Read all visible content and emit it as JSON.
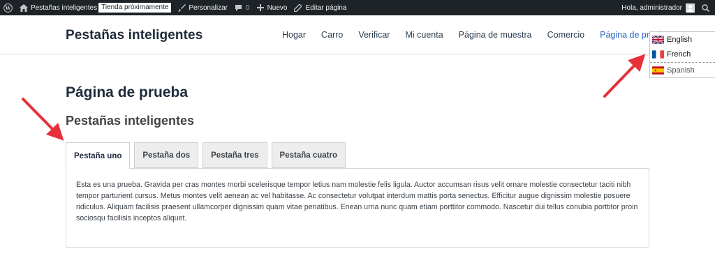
{
  "admin_bar": {
    "site_name": "Pestañas inteligentes",
    "badge": "Tienda próximamente",
    "customize": "Personalizar",
    "comments_count": "0",
    "new_label": "Nuevo",
    "edit_page": "Editar página",
    "greeting": "Hola, administrador"
  },
  "header": {
    "site_title": "Pestañas inteligentes",
    "nav": [
      "Hogar",
      "Carro",
      "Verificar",
      "Mi cuenta",
      "Página de muestra",
      "Comercio",
      "Página de prueba"
    ]
  },
  "languages": [
    "English",
    "French",
    "Spanish"
  ],
  "page": {
    "title": "Página de prueba",
    "section_title": "Pestañas inteligentes",
    "tabs": [
      "Pestaña uno",
      "Pestaña dos",
      "Pestaña tres",
      "Pestaña cuatro"
    ],
    "active_tab": "Pestaña uno",
    "panel_text": "Esta es una prueba. Gravida per cras montes morbi scelerisque tempor letius nam molestie felis ligula. Auctor accumsan risus velit ornare molestie consectetur taciti nibh tempor parturient cursus. Metus montes velit aenean ac vel habitasse. Ac consectetur volutpat interdum mattis porta senectus. Efficitur augue dignissim molestie posuere ridiculus. Aliquam facilisis praesent ullamcorper dignissim quam vitae penatibus. Enean urna nunc quam etiam porttitor commodo. Nascetur dui tellus conubia porttitor proin sociosqu facilisis inceptos aliquet."
  },
  "colors": {
    "admin_bar": "#1d2327",
    "link_active": "#2a66c7",
    "annotation_arrow": "#e8303a"
  }
}
